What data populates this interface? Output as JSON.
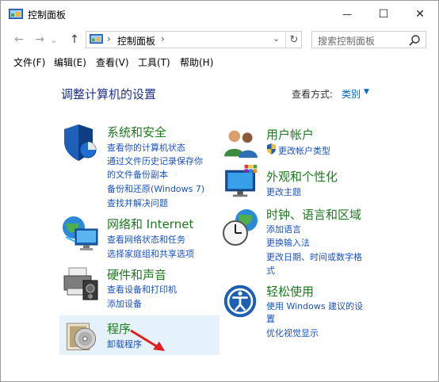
{
  "window": {
    "title": "控制面板",
    "controls": {
      "minimize": "—",
      "maximize": "☐",
      "close": "✕"
    }
  },
  "nav": {
    "back": "←",
    "forward": "→",
    "recent": "⌄",
    "up": "↑",
    "address": {
      "separator": "›",
      "path": "控制面板",
      "dropdown": "⌄",
      "refresh": "↻"
    },
    "search": {
      "placeholder": "搜索控制面板"
    }
  },
  "menu": [
    "文件(F)",
    "编辑(E)",
    "查看(V)",
    "工具(T)",
    "帮助(H)"
  ],
  "content": {
    "heading": "调整计算机的设置",
    "view_by": {
      "label": "查看方式:",
      "value": "类别"
    }
  },
  "categories": [
    {
      "title": "系统和安全",
      "links": [
        "查看你的计算机状态",
        "通过文件历史记录保存你",
        "的文件备份副本",
        "备份和还原(Windows 7)",
        "查找并解决问题"
      ]
    },
    {
      "title": "网络和 Internet",
      "links": [
        "查看网络状态和任务",
        "选择家庭组和共享选项"
      ]
    },
    {
      "title": "硬件和声音",
      "links": [
        "查看设备和打印机",
        "添加设备"
      ]
    },
    {
      "title": "程序",
      "links": [
        "卸载程序"
      ]
    },
    {
      "title": "用户帐户",
      "links": [
        "更改帐户类型"
      ]
    },
    {
      "title": "外观和个性化",
      "links": [
        "更改主题"
      ]
    },
    {
      "title": "时钟、语言和区域",
      "links": [
        "添加语言",
        "更换输入法",
        "更改日期、时间或数字格",
        "式"
      ]
    },
    {
      "title": "轻松使用",
      "links": [
        "使用 Windows 建议的设",
        "置",
        "优化视觉显示"
      ]
    }
  ],
  "colors": {
    "heading": "#1e3287",
    "category_title": "#1d7a1d",
    "link": "#1a52c4",
    "highlight": "#e5f1fb",
    "annotation_arrow": "#e02020"
  },
  "icons": [
    "control-panel-icon",
    "shield-icon",
    "network-globe-icon",
    "printer-icon",
    "programs-disc-icon",
    "users-icon",
    "monitor-palette-icon",
    "clock-globe-icon",
    "ease-of-access-icon",
    "red-arrow-annotation"
  ]
}
